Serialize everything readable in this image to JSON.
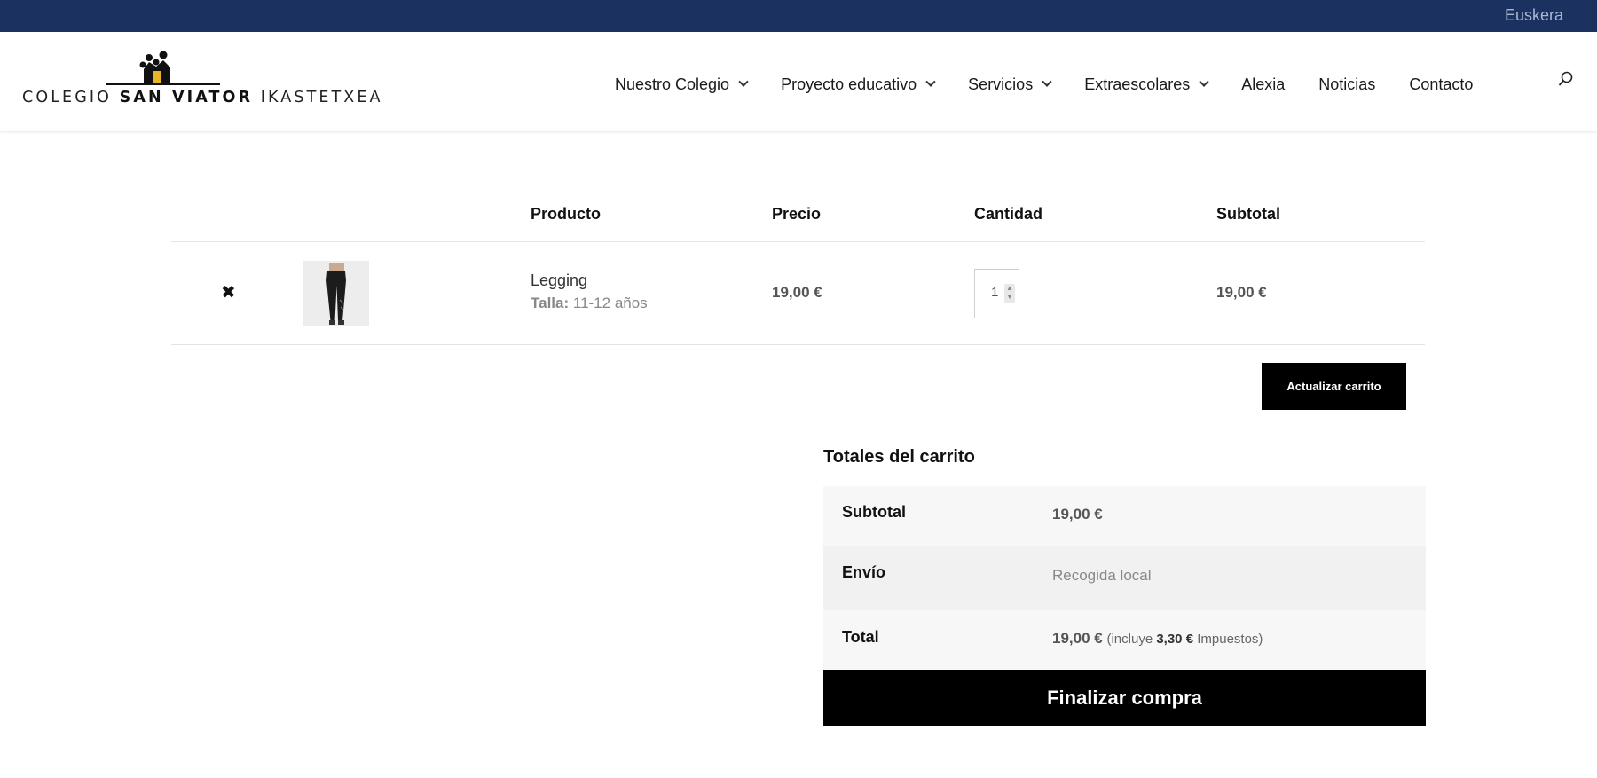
{
  "topbar": {
    "language_link": "Euskera",
    "bg_color": "#1b3160"
  },
  "logo": {
    "prefix": "COLEGIO",
    "brand": "SAN VIATOR",
    "suffix": "IKASTETXEA"
  },
  "nav": {
    "items": [
      {
        "label": "Nuestro Colegio",
        "has_dropdown": true
      },
      {
        "label": "Proyecto educativo",
        "has_dropdown": true
      },
      {
        "label": "Servicios",
        "has_dropdown": true
      },
      {
        "label": "Extraescolares",
        "has_dropdown": true
      },
      {
        "label": "Alexia",
        "has_dropdown": false
      },
      {
        "label": "Noticias",
        "has_dropdown": false
      },
      {
        "label": "Contacto",
        "has_dropdown": false
      }
    ],
    "search_icon": "search-icon"
  },
  "cart": {
    "headers": {
      "product": "Producto",
      "price": "Precio",
      "quantity": "Cantidad",
      "subtotal": "Subtotal"
    },
    "items": [
      {
        "remove_icon": "close-icon",
        "remove_glyph": "✖",
        "name": "Legging",
        "variation_label": "Talla:",
        "variation_value": "11-12 años",
        "price": "19,00 €",
        "quantity": "1",
        "subtotal": "19,00 €"
      }
    ],
    "update_button": "Actualizar carrito"
  },
  "totals": {
    "title": "Totales del carrito",
    "subtotal_label": "Subtotal",
    "subtotal_value": "19,00 €",
    "shipping_label": "Envío",
    "shipping_value": "Recogida local",
    "total_label": "Total",
    "total_value": "19,00 €",
    "tax_prefix": "(incluye",
    "tax_amount": "3,30 €",
    "tax_suffix": "Impuestos)",
    "checkout_button": "Finalizar compra"
  }
}
